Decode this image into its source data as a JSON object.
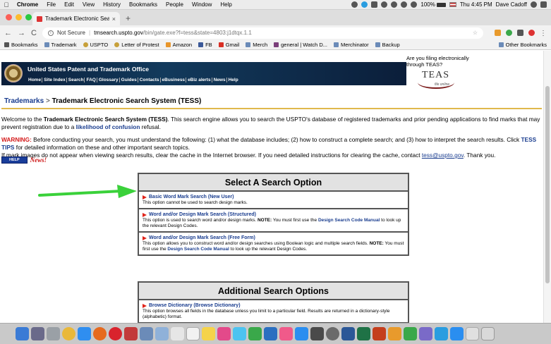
{
  "menubar": {
    "app_name": "Chrome",
    "items": [
      "File",
      "Edit",
      "View",
      "History",
      "Bookmarks",
      "People",
      "Window",
      "Help"
    ],
    "battery": "100%",
    "clock": "Thu 4:45 PM",
    "user": "Dave Cadoff"
  },
  "tab": {
    "title": "Trademark Electronic Search S",
    "close": "×",
    "new_tab": "+"
  },
  "toolbar": {
    "back": "←",
    "forward": "→",
    "reload": "C",
    "security": "Not Secure",
    "url_domain": "tmsearch.uspto.gov",
    "url_path": "/bin/gate.exe?f=tess&state=4803:j1dtqx.1.1"
  },
  "bookmarks": {
    "items": [
      "Bookmarks",
      "Trademark",
      "USPTO",
      "Letter of Protest",
      "Amazon",
      "FB",
      "Gmail",
      "Merch",
      "general | Watch D...",
      "Merchinator",
      "Backup"
    ],
    "other": "Other Bookmarks"
  },
  "uspto": {
    "title": "United States Patent and Trademark Office",
    "nav": [
      "Home",
      "Site Index",
      "Search",
      "FAQ",
      "Glossary",
      "Guides",
      "Contacts",
      "eBusiness",
      "eBiz alerts",
      "News",
      "Help"
    ]
  },
  "teas": {
    "question": "Are you filing electronically through TEAS?",
    "logo": "TEAS",
    "logo_sub": "file online"
  },
  "breadcrumb": {
    "link": "Trademarks",
    "sep": ">",
    "current": "Trademark Electronic Search System (TESS)"
  },
  "welcome": {
    "prefix": "Welcome to the ",
    "system_name": "Trademark Electronic Search System (TESS)",
    "middle": ". This search engine allows you to search the USPTO's database of registered trademarks and prior pending applications to find marks that may prevent registration due to a ",
    "link": "likelihood of confusion",
    "suffix": " refusal."
  },
  "warning": {
    "label": "WARNING:",
    "text1": " Before conducting your search, you must understand the following: (1) what the database includes; (2) how to construct a complete search; and (3) how to interpret the search results. Click ",
    "tips_link": "TESS TIPS",
    "text2": " for detailed information on these and other important search topics.",
    "text3": "If mark images do not appear when viewing search results, clear the cache in the Internet browser. If you need detailed instructions for clearing the cache, contact ",
    "email": "tess@uspto.gov",
    "text4": ". Thank you."
  },
  "help_button": "HELP",
  "news": "News!",
  "select_box": {
    "title": "Select A Search Option",
    "options": [
      {
        "title": "Basic Word Mark Search (New User)",
        "desc": "This option cannot be used to search design marks."
      },
      {
        "title": "Word and/or Design Mark Search (Structured)",
        "desc_pre": "This option is used to search word and/or design marks. ",
        "note": "NOTE:",
        "desc_mid": " You must first use the ",
        "link": "Design Search Code Manual",
        "desc_post": " to look up the relevant Design Codes."
      },
      {
        "title": "Word and/or Design Mark Search (Free Form)",
        "desc_pre": "This option allows you to construct word and/or design searches using Boolean logic and multiple search fields. ",
        "note": "NOTE:",
        "desc_mid": " You must first use the ",
        "link": "Design Search Code Manual",
        "desc_post": " to look up the relevant Design Codes."
      }
    ]
  },
  "additional_box": {
    "title": "Additional Search Options",
    "option_title": "Browse Dictionary (Browse Dictionary)",
    "option_desc": "This option browses all fields in the database unless you limit to a particular field. Results are returned in a dictionary-style (alphabetic) format."
  },
  "colors": {
    "link_blue": "#1a3d8f",
    "warning_red": "#d41a1a",
    "accent_gold": "#e0b84c",
    "arrow_green": "#3ad13a"
  }
}
